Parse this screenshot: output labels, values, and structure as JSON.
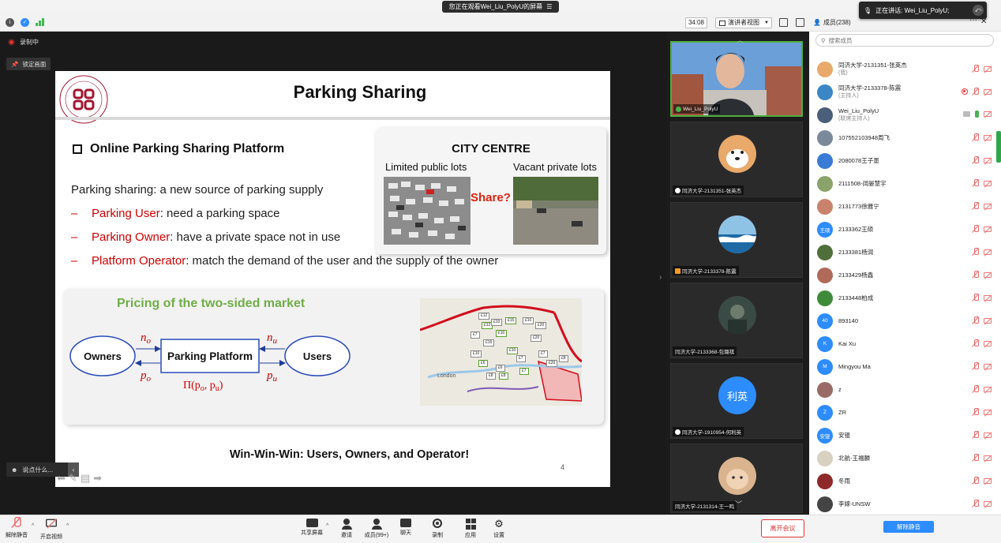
{
  "share_banner": {
    "text": "您正在观看Wei_Liu_PolyU的屏幕",
    "icon": "menu-icon"
  },
  "topbar": {
    "timer": "34:08",
    "view_label": "演讲者视图",
    "members_title": "成员(238)"
  },
  "speaking": {
    "text": "正在讲话: Wei_Liu_PolyU;"
  },
  "recording": {
    "label": "录制中",
    "lock_label": "锁定画面"
  },
  "slide": {
    "title": "Parking Sharing",
    "section1": "Online Parking Sharing Platform",
    "intro": "Parking sharing: a new source of parking supply",
    "bullets": [
      {
        "dash": "–",
        "key": "Parking User",
        "rest": ": need a parking space"
      },
      {
        "dash": "–",
        "key": "Parking Owner",
        "rest": ": have a private space not in use"
      },
      {
        "dash": "–",
        "key": "Platform Operator",
        "rest": ": match the demand of the user and the supply of the owner"
      }
    ],
    "city": {
      "title": "CITY CENTRE",
      "left_label": "Limited public lots",
      "right_label": "Vacant private lots",
      "share": "Share?"
    },
    "pricing": {
      "title": "Pricing of the two-sided market",
      "owners": "Owners",
      "platform": "Parking Platform",
      "users": "Users",
      "n_o": "n",
      "n_o_sub": "o",
      "p_o": "p",
      "p_o_sub": "o",
      "n_u": "n",
      "n_u_sub": "u",
      "p_u": "p",
      "p_u_sub": "u",
      "profit": "Π(p",
      "profit_sub1": "o",
      "profit_mid": ", p",
      "profit_sub2": "u",
      "profit_end": ")"
    },
    "map": {
      "label": "London",
      "tags": [
        "£12",
        "£12",
        "£7",
        "£10",
        "£15",
        "£10",
        "£20",
        "£10",
        "£20",
        "£16",
        "£10",
        "£7",
        "£7",
        "£6",
        "£6",
        "£8",
        "£8",
        "£20",
        "£8",
        "£7",
        "£10"
      ]
    },
    "winwin": "Win-Win-Win: Users, Owners, and Operator!",
    "page_number": "4"
  },
  "chat_hint": {
    "text": "说点什么..."
  },
  "video_tiles": [
    {
      "name": "Wei_Liu_PolyU",
      "kind": "photo"
    },
    {
      "name": "同济大学-2131351-张英杰",
      "kind": "dog"
    },
    {
      "name": "同济大学-2133378-陈震",
      "kind": "sea"
    },
    {
      "name": "同济大学-2133368-包璐祺",
      "kind": "dark"
    },
    {
      "name": "同济大学-1910954-何利英",
      "kind": "text",
      "text": "利英",
      "color": "#2d8cff"
    },
    {
      "name": "同济大学-2131314-王一鸣",
      "kind": "cat"
    }
  ],
  "participants": {
    "search_placeholder": "搜索成员",
    "items": [
      {
        "name": "同济大学-2131351-张英杰",
        "role": "(我)",
        "av": "dog",
        "icons": [
          "mic-off",
          "cam-off"
        ]
      },
      {
        "name": "同济大学-2133378-陈震",
        "role": "(主持人)",
        "av": "sea",
        "icons": [
          "rec",
          "mic-off",
          "cam-off"
        ]
      },
      {
        "name": "Wei_Liu_PolyU",
        "role": "(联席主持人)",
        "av": "photo",
        "icons": [
          "screen",
          "mic-on",
          "cam-off"
        ]
      },
      {
        "name": "107552103948周飞",
        "av": "gray",
        "icons": [
          "mic-off",
          "cam-off"
        ]
      },
      {
        "name": "2080078王子墨",
        "av": "blue",
        "icons": [
          "mic-off",
          "cam-off"
        ]
      },
      {
        "name": "2111508-阔晏慧宇",
        "av": "land",
        "icons": [
          "mic-off",
          "cam-off"
        ]
      },
      {
        "name": "2131773徐雅宁",
        "av": "warm",
        "icons": [
          "mic-off",
          "cam-off"
        ]
      },
      {
        "name": "2133362王硕",
        "av": "text",
        "text": "王硕",
        "icons": [
          "mic-off",
          "cam-off"
        ]
      },
      {
        "name": "2133381杨润",
        "av": "green",
        "icons": [
          "mic-off",
          "cam-off"
        ]
      },
      {
        "name": "2133429杨鑫",
        "av": "mixed",
        "icons": [
          "mic-off",
          "cam-off"
        ]
      },
      {
        "name": "2133448柏成",
        "av": "leaf",
        "icons": [
          "mic-off",
          "cam-off"
        ]
      },
      {
        "name": "893140",
        "av": "text",
        "text": "40",
        "icons": [
          "mic-off",
          "cam-off"
        ]
      },
      {
        "name": "Kai Xu",
        "av": "text",
        "text": "K",
        "icons": [
          "mic-off",
          "cam-off"
        ]
      },
      {
        "name": "Mingyou Ma",
        "av": "text",
        "text": "M",
        "icons": [
          "mic-off",
          "cam-off"
        ]
      },
      {
        "name": "z",
        "av": "girl",
        "icons": [
          "mic-off",
          "cam-off"
        ]
      },
      {
        "name": "ZR",
        "av": "text",
        "text": "Z",
        "icons": [
          "mic-off",
          "cam-off"
        ]
      },
      {
        "name": "安锟",
        "av": "text",
        "text": "安锟",
        "icons": [
          "mic-off",
          "cam-off"
        ]
      },
      {
        "name": "北航-王福麟",
        "av": "flower",
        "icons": [
          "mic-off",
          "cam-off"
        ]
      },
      {
        "name": "冬雨",
        "av": "red",
        "icons": [
          "mic-off",
          "cam-off"
        ]
      },
      {
        "name": "李嫁-UNSW",
        "av": "bw",
        "icons": [
          "mic-off",
          "cam-off"
        ]
      }
    ]
  },
  "bottombar": {
    "unmute": "解除静音",
    "start_video": "开启视频",
    "share": "共享屏幕",
    "invite": "邀请",
    "members": "成员(99+)",
    "chat": "聊天",
    "record": "录制",
    "apps": "应用",
    "settings": "设置",
    "leave": "离开会议",
    "unmute_all": "解除静音"
  },
  "colors": {
    "accent": "#2d8cff",
    "danger": "#dd3333",
    "pricing_green": "#70ad47",
    "slide_red": "#cc0000"
  }
}
